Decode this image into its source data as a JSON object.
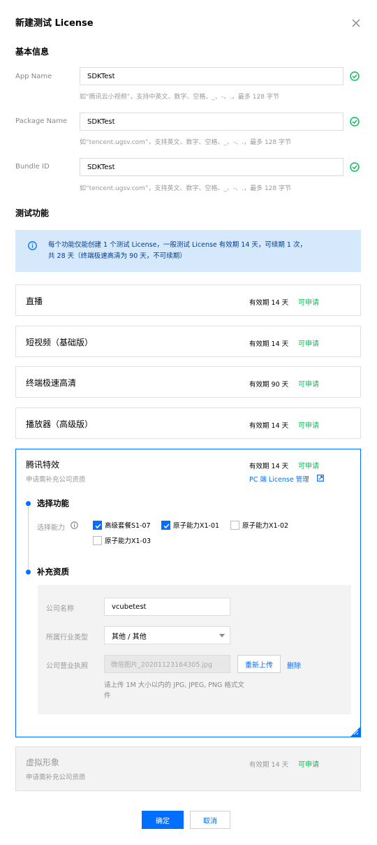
{
  "dialog": {
    "title": "新建测试 License",
    "close_icon": "close-icon"
  },
  "basic": {
    "section_title": "基本信息",
    "fields": [
      {
        "label": "App Name",
        "value": "SDKTest",
        "hint": "如“腾讯云小视频”，支持中英文、数字、空格、_、-、.，最多 128 字节"
      },
      {
        "label": "Package Name",
        "value": "SDKTest",
        "hint": "如“tencent.ugsv.com”，支持英文、数字、空格、_、-、.，最多 128 字节"
      },
      {
        "label": "Bundle ID",
        "value": "SDKTest",
        "hint": "如“tencent.ugsv.com”，支持英文、数字、空格、_、-、.，最多 128 字节"
      }
    ]
  },
  "test": {
    "section_title": "测试功能",
    "info_line1": "每个功能仅能创建 1 个测试 License，一般测试 License 有效期 14 天，可续期 1 次，",
    "info_line2": "共 28 天（终端极速高清为 90 天，不可续期）",
    "cards": [
      {
        "name": "直播",
        "validity": "有效期 14 天",
        "status": "可申请"
      },
      {
        "name": "短视频（基础版）",
        "validity": "有效期 14 天",
        "status": "可申请"
      },
      {
        "name": "终端极速高清",
        "validity": "有效期 90 天",
        "status": "可申请"
      },
      {
        "name": "播放器（高级版）",
        "validity": "有效期 14 天",
        "status": "可申请"
      }
    ],
    "effects": {
      "name": "腾讯特效",
      "sub": "申请需补充公司资质",
      "validity": "有效期 14 天",
      "status": "可申请",
      "link": "PC 端 License 管理",
      "step1_title": "选择功能",
      "ability_label": "选择能力",
      "options": [
        {
          "label": "高级套餐S1-07",
          "checked": true
        },
        {
          "label": "原子能力X1-01",
          "checked": true
        },
        {
          "label": "原子能力X1-02",
          "checked": false
        },
        {
          "label": "原子能力X1-03",
          "checked": false
        }
      ],
      "step2_title": "补充资质",
      "company_label": "公司名称",
      "company_value": "vcubetest",
      "industry_label": "所属行业类型",
      "industry_value": "其他 / 其他",
      "license_label": "公司营业执照",
      "license_file": "微信图片_20201123164305.jpg",
      "reupload": "重新上传",
      "delete": "删除",
      "upload_hint_1": "请上传 1M 大小以内的 JPG, JPEG, PNG 格式文",
      "upload_hint_2": "件"
    },
    "virtual": {
      "name": "虚拟形象",
      "sub": "申请需补充公司资质",
      "validity": "有效期 14 天",
      "status": "可申请"
    }
  },
  "footer": {
    "confirm": "确定",
    "cancel": "取消"
  },
  "colors": {
    "primary": "#006eff",
    "success": "#0abf5b",
    "info_bg": "#d5e8fc"
  }
}
